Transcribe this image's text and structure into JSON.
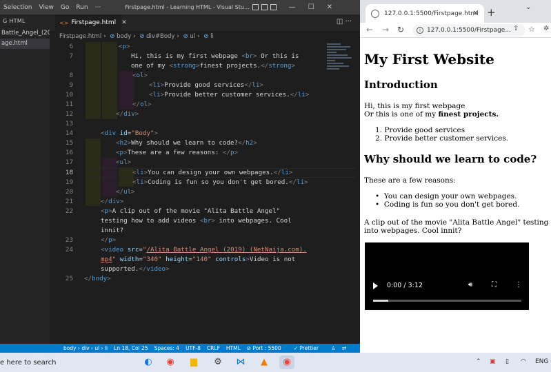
{
  "vscode": {
    "menu": [
      "Selection",
      "View",
      "Go",
      "Run",
      "···"
    ],
    "title": "Firstpage.html - Learning HTML - Visual Stu...",
    "sidebar": {
      "header": "G HTML",
      "items": [
        "Battle_Angel_(20...",
        "age.html"
      ]
    },
    "tab_label": "Firstpage.html",
    "breadcrumb": [
      "Firstpage.html",
      "body",
      "div#Body",
      "ul",
      "li"
    ],
    "line_numbers": [
      "6",
      "7",
      "",
      "8",
      "9",
      "10",
      "11",
      "12",
      "13",
      "14",
      "15",
      "16",
      "17",
      "18",
      "19",
      "20",
      "21",
      "22",
      "",
      "",
      "23",
      "24",
      "",
      "",
      "25"
    ],
    "status": {
      "path": "body › div › ul › li",
      "position": "Ln 18, Col 25",
      "spaces": "Spaces: 4",
      "encoding": "UTF-8",
      "eol": "CRLF",
      "language": "HTML",
      "port": "Port : 5500",
      "prettier": "Prettier"
    }
  },
  "browser": {
    "tab_title": "127.0.0.1:5500/Firstpage.html",
    "address": "127.0.0.1:5500/Firstpage...",
    "page": {
      "h1": "My First Website",
      "intro_heading": "Introduction",
      "intro_line1": "Hi, this is my first webpage",
      "intro_line2a": "Or this is one of my ",
      "intro_line2b": "finest projects.",
      "services": [
        "Provide good services",
        "Provide better customer services."
      ],
      "why_heading": "Why should we learn to code?",
      "reasons_intro": "These are a few reasons:",
      "reasons": [
        "You can design your own webpages.",
        "Coding is fun so you don't get bored."
      ],
      "clip_line1": "A clip out of the movie \"Alita Battle Angel\" testing how to a",
      "clip_line2": "into webpages. Cool innit?",
      "video_time": "0:00 / 3:12",
      "video_progress": 0.1
    }
  },
  "taskbar": {
    "search": "e here to search",
    "lang": "ENG"
  }
}
